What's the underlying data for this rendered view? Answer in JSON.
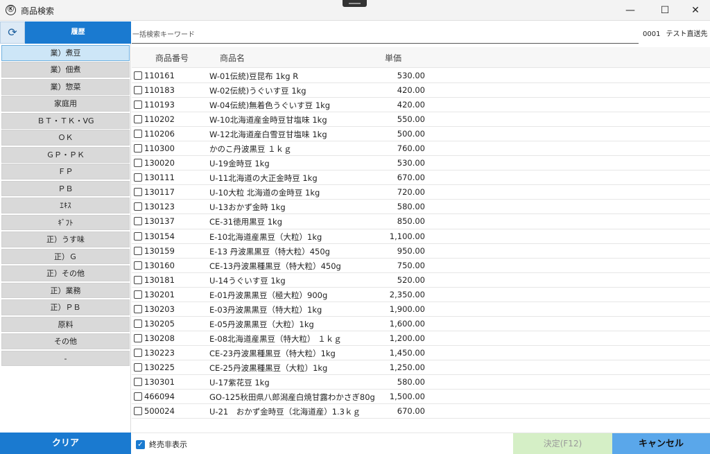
{
  "window": {
    "title": "商品検索",
    "app_icon": "Ⓚ",
    "min_glyph": "—",
    "max_glyph": "☐",
    "close_glyph": "✕"
  },
  "sidebar": {
    "refresh_icon": "⟳",
    "history_label": "履歴",
    "categories": [
      "業）煮豆",
      "業）佃煮",
      "業）惣菜",
      "家庭用",
      "ＢＴ・ＴＫ・VG",
      "ＯＫ",
      "ＧＰ・ＰＫ",
      "ＦＰ",
      "ＰＢ",
      "ｴｷｽ",
      "ｷﾞﾌﾄ",
      "正）うす味",
      "正）Ｇ",
      "正）その他",
      "正）業務",
      "正）ＰＢ",
      "原料",
      "その他",
      "-"
    ],
    "clear_label": "クリア"
  },
  "search": {
    "placeholder": "一括検索キーワード",
    "customer_code": "0001",
    "customer_name": "テスト直送先"
  },
  "table": {
    "headers": {
      "code": "商品番号",
      "name": "商品名",
      "price": "単価"
    },
    "rows": [
      {
        "code": "110161",
        "name": "W-01伝統)豆昆布 1kg R",
        "price": "530.00"
      },
      {
        "code": "110183",
        "name": "W-02伝統)うぐいす豆 1kg",
        "price": "420.00"
      },
      {
        "code": "110193",
        "name": "W-04伝統)無着色うぐいす豆 1kg",
        "price": "420.00"
      },
      {
        "code": "110202",
        "name": "W-10北海道産金時豆甘塩味 1kg",
        "price": "550.00"
      },
      {
        "code": "110206",
        "name": "W-12北海道産白雪豆甘塩味 1kg",
        "price": "500.00"
      },
      {
        "code": "110300",
        "name": "かのこ丹波黒豆 １ｋｇ",
        "price": "760.00"
      },
      {
        "code": "130020",
        "name": "U-19金時豆 1kg",
        "price": "530.00"
      },
      {
        "code": "130111",
        "name": "U-11北海道の大正金時豆 1kg",
        "price": "670.00"
      },
      {
        "code": "130117",
        "name": "U-10大粒 北海道の金時豆 1kg",
        "price": "720.00"
      },
      {
        "code": "130123",
        "name": "U-13おかず金時 1kg",
        "price": "580.00"
      },
      {
        "code": "130137",
        "name": "CE-31徳用黒豆 1kg",
        "price": "850.00"
      },
      {
        "code": "130154",
        "name": "E-10北海道産黒豆（大粒）1kg",
        "price": "1,100.00"
      },
      {
        "code": "130159",
        "name": "E-13 丹波黒黒豆（特大粒）450g",
        "price": "950.00"
      },
      {
        "code": "130160",
        "name": "CE-13丹波黒種黒豆（特大粒）450g",
        "price": "750.00"
      },
      {
        "code": "130181",
        "name": "U-14うぐいす豆 1kg",
        "price": "520.00"
      },
      {
        "code": "130201",
        "name": "E-01丹波黒黒豆（極大粒）900g",
        "price": "2,350.00"
      },
      {
        "code": "130203",
        "name": "E-03丹波黒黒豆（特大粒）1kg",
        "price": "1,900.00"
      },
      {
        "code": "130205",
        "name": "E-05丹波黒黒豆（大粒）1kg",
        "price": "1,600.00"
      },
      {
        "code": "130208",
        "name": "E-08北海道産黒豆（特大粒） １ｋｇ",
        "price": "1,200.00"
      },
      {
        "code": "130223",
        "name": "CE-23丹波黒種黒豆（特大粒）1kg",
        "price": "1,450.00"
      },
      {
        "code": "130225",
        "name": "CE-25丹波黒種黒豆（大粒）1kg",
        "price": "1,250.00"
      },
      {
        "code": "130301",
        "name": "U-17紫花豆 1kg",
        "price": "580.00"
      },
      {
        "code": "466094",
        "name": "GO-125秋田県八郎潟産白焼甘露わかさぎ80g",
        "price": "1,500.00"
      },
      {
        "code": "500024",
        "name": "U-21　おかず金時豆（北海道産）1.3ｋｇ",
        "price": "670.00"
      }
    ]
  },
  "footer": {
    "hide_discontinued_label": "終売非表示",
    "hide_discontinued_checked": true,
    "decide_label": "決定(F12)",
    "cancel_label": "キャンセル"
  },
  "colors": {
    "accent": "#1a7ad0",
    "cancel": "#5aa7ea",
    "decide_disabled": "#d5efc6",
    "category_bg": "#d9d9d9",
    "category_selected": "#cde6f7"
  }
}
